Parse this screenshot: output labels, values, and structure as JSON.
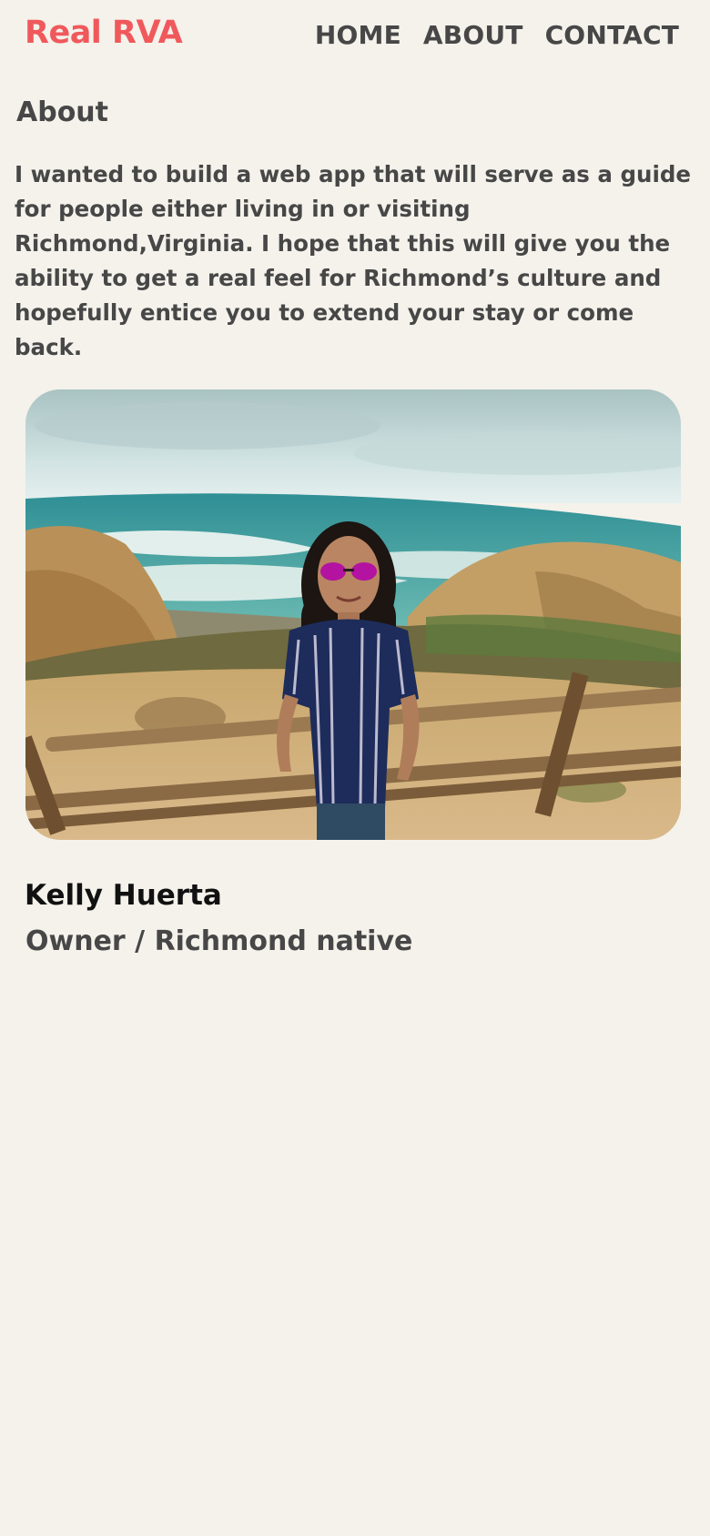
{
  "navbar": {
    "brand": "Real RVA",
    "links": [
      {
        "label": "HOME"
      },
      {
        "label": "ABOUT"
      },
      {
        "label": "CONTACT"
      }
    ]
  },
  "about": {
    "heading": "About",
    "body": "I wanted to build a web app that will serve as a guide for people either living in or visiting Richmond,Virginia. I hope that this will give you the ability to get a real feel for Richmond’s culture and hopefully entice you to extend your stay or come back."
  },
  "profile": {
    "name": "Kelly Huerta",
    "role": "Owner / Richmond native"
  },
  "colors": {
    "background": "#f4f2eb",
    "brand": "#f0595c",
    "text": "#474747",
    "name_text": "#111111"
  }
}
